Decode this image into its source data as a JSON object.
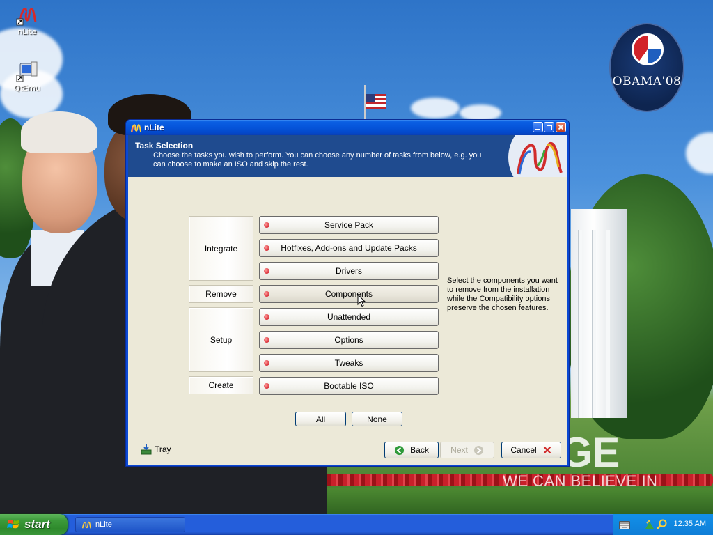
{
  "desktop": {
    "icons": [
      {
        "label": "nLite",
        "icon": "nlite-icon"
      },
      {
        "label": "QtEmu",
        "icon": "qtemu-icon"
      }
    ],
    "wallpaper": {
      "logo_text": "OBAMA'08",
      "slogan_big": "ANGE",
      "slogan_small": "WE CAN BELIEVE IN"
    }
  },
  "window": {
    "title": "nLite",
    "header": {
      "title": "Task Selection",
      "description": "Choose the tasks you wish to perform. You can choose any number of tasks from below, e.g. you can choose to make an ISO and skip the rest."
    },
    "groups": [
      {
        "label": "Integrate"
      },
      {
        "label": "Remove"
      },
      {
        "label": "Setup"
      },
      {
        "label": "Create"
      }
    ],
    "tasks": [
      {
        "label": "Service Pack"
      },
      {
        "label": "Hotfixes, Add-ons and Update Packs"
      },
      {
        "label": "Drivers"
      },
      {
        "label": "Components"
      },
      {
        "label": "Unattended"
      },
      {
        "label": "Options"
      },
      {
        "label": "Tweaks"
      },
      {
        "label": "Bootable ISO"
      }
    ],
    "task_description": "Select the components you want to remove from the installation while the Compatibility options preserve the chosen features.",
    "select_all": "All",
    "select_none": "None",
    "footer": {
      "tray": "Tray",
      "back": "Back",
      "next": "Next",
      "cancel": "Cancel"
    }
  },
  "taskbar": {
    "start": "start",
    "task_item": "nLite",
    "clock": "12:35 AM"
  },
  "colors": {
    "xp_blue": "#0554da",
    "header_blue": "#1f4b8f",
    "dialog_bg": "#ece9d8",
    "start_green": "#3c9a3a",
    "task_dot": "#d9333b"
  }
}
